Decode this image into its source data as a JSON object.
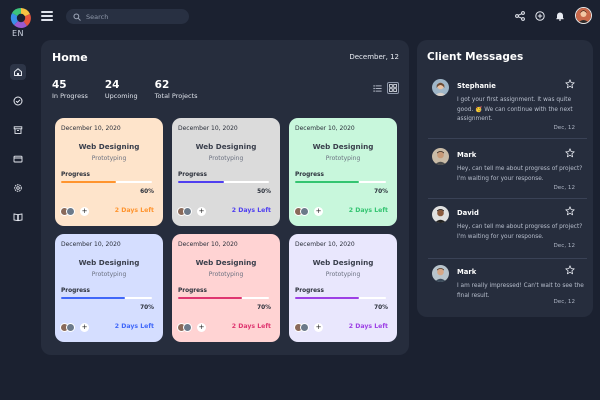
{
  "app": {
    "logo_text": "EN"
  },
  "search": {
    "placeholder": "Search"
  },
  "sidebar": {
    "items": [
      {
        "name": "home-icon"
      },
      {
        "name": "check-circle-icon"
      },
      {
        "name": "archive-icon"
      },
      {
        "name": "credit-card-icon"
      },
      {
        "name": "settings-icon"
      },
      {
        "name": "book-icon"
      }
    ]
  },
  "home": {
    "title": "Home",
    "date": "December, 12",
    "stats": [
      {
        "value": "45",
        "label": "In Progress"
      },
      {
        "value": "24",
        "label": "Upcoming"
      },
      {
        "value": "62",
        "label": "Total Projects"
      }
    ],
    "cards": [
      {
        "date": "December 10, 2020",
        "title": "Web Designing",
        "subtitle": "Prototyping",
        "progress_label": "Progress",
        "progress": 60,
        "progress_text": "60%",
        "days_left": "2 Days Left",
        "bg": "#fee4cb",
        "accent": "#ff942e",
        "days_color": "#ff942e"
      },
      {
        "date": "December 10, 2020",
        "title": "Web Designing",
        "subtitle": "Prototyping",
        "progress_label": "Progress",
        "progress": 50,
        "progress_text": "50%",
        "days_left": "2 Days Left",
        "bg": "#dbdbdb",
        "accent": "#4f3ff0",
        "days_color": "#4f3ff0"
      },
      {
        "date": "December 10, 2020",
        "title": "Web Designing",
        "subtitle": "Prototyping",
        "progress_label": "Progress",
        "progress": 70,
        "progress_text": "70%",
        "days_left": "2 Days Left",
        "bg": "#c8f7dc",
        "accent": "#34c471",
        "days_color": "#34c471"
      },
      {
        "date": "December 10, 2020",
        "title": "Web Designing",
        "subtitle": "Prototyping",
        "progress_label": "Progress",
        "progress": 70,
        "progress_text": "70%",
        "days_left": "2 Days Left",
        "bg": "#d5deff",
        "accent": "#4067f9",
        "days_color": "#4067f9"
      },
      {
        "date": "December 10, 2020",
        "title": "Web Designing",
        "subtitle": "Prototyping",
        "progress_label": "Progress",
        "progress": 70,
        "progress_text": "70%",
        "days_left": "2 Days Left",
        "bg": "#ffd3d3",
        "accent": "#df3670",
        "days_color": "#df3670"
      },
      {
        "date": "December 10, 2020",
        "title": "Web Designing",
        "subtitle": "Prototyping",
        "progress_label": "Progress",
        "progress": 70,
        "progress_text": "70%",
        "days_left": "2 Days Left",
        "bg": "#e9e7fd",
        "accent": "#9d40e5",
        "days_color": "#9d40e5"
      }
    ]
  },
  "messages": {
    "title": "Client Messages",
    "items": [
      {
        "name": "Stephanie",
        "text": "I got your first assignment. It was quite good. 🥳 We can continue with the next assignment.",
        "date": "Dec, 12"
      },
      {
        "name": "Mark",
        "text": "Hey, can tell me about progress of project? I'm waiting for your response.",
        "date": "Dec, 12"
      },
      {
        "name": "David",
        "text": "Hey, can tell me about progress of project? I'm waiting for your response.",
        "date": "Dec, 12"
      },
      {
        "name": "Mark",
        "text": "I am really impressed! Can't wait to see the final result.",
        "date": "Dec, 12"
      }
    ]
  }
}
